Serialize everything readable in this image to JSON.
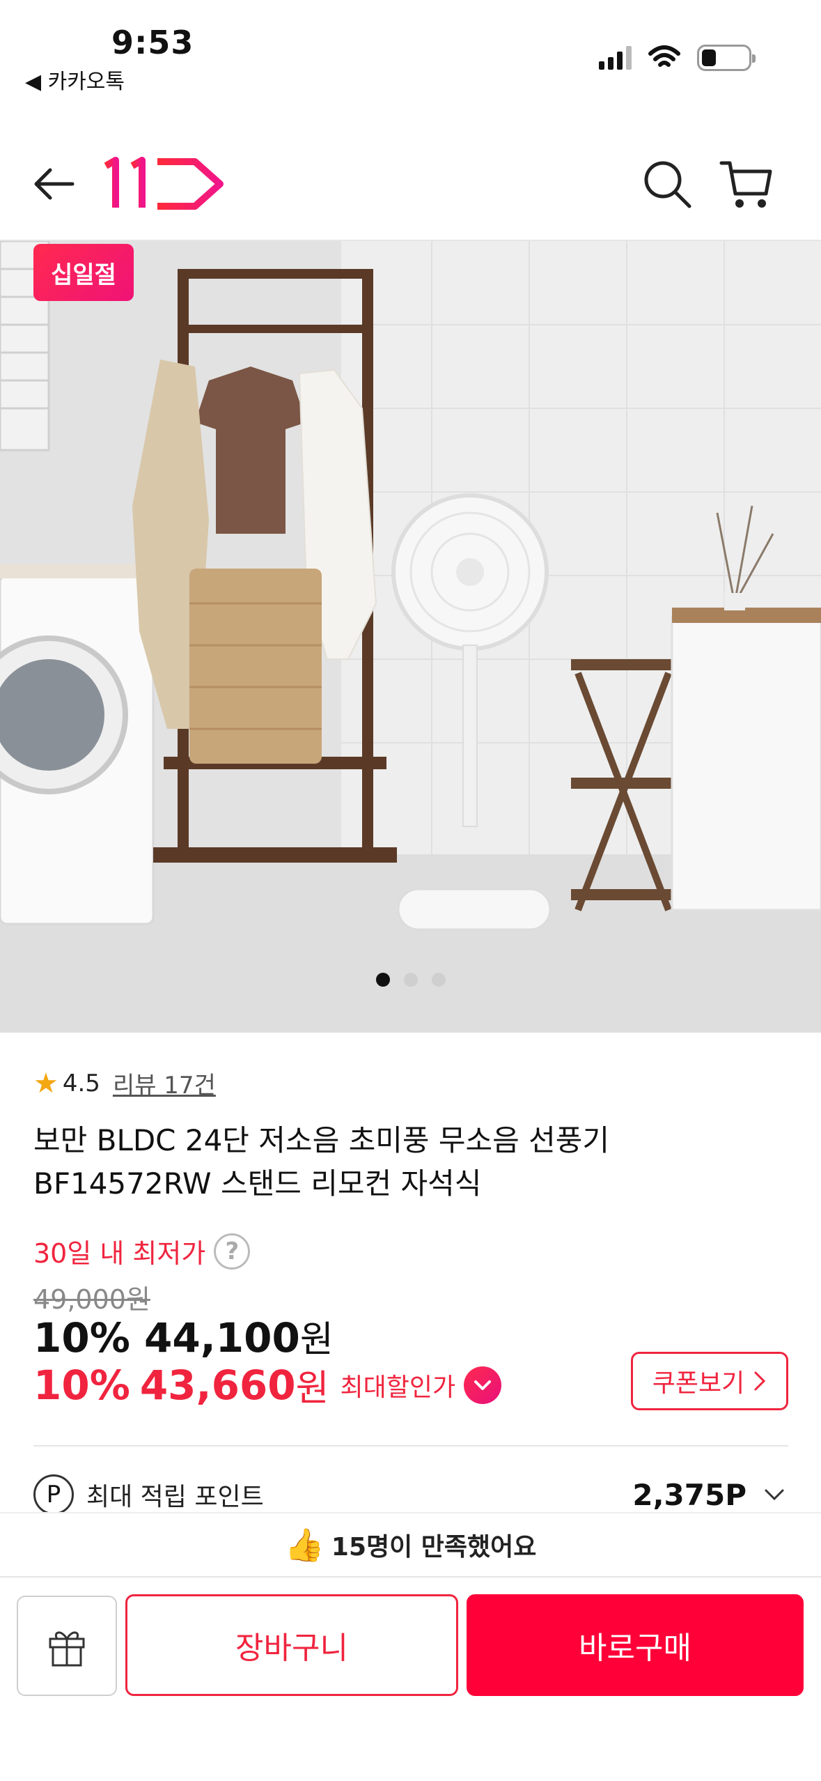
{
  "status_bar": {
    "time": "9:53",
    "back_app": "◀ 카카오톡"
  },
  "header": {
    "logo_text": "11",
    "icons": [
      "back-arrow-icon",
      "logo-icon",
      "search-icon",
      "cart-icon"
    ]
  },
  "hero": {
    "badge": "십일절",
    "dots_count": 3,
    "active_dot": 1
  },
  "product": {
    "rating": "4.5",
    "review_link": "리뷰 17건",
    "title_line1": "보만 BLDC 24단 저소음 초미풍 무소음 선풍기",
    "title_line2": "BF14572RW 스탠드 리모컨 자석식",
    "lowest_label": "30일 내 최저가",
    "original_price": "49,000원",
    "discount_pct": "10%",
    "price": "44,100",
    "price_unit": "원",
    "max_discount_pct": "10%",
    "max_price": "43,660",
    "max_price_unit": "원",
    "max_label": "최대할인가",
    "coupon_button": "쿠폰보기",
    "points_label": "최대 적립 포인트",
    "points_value": "2,375P"
  },
  "satisfaction": {
    "text": "15명이 만족했어요"
  },
  "actions": {
    "cart": "장바구니",
    "buy": "바로구매"
  },
  "colors": {
    "accent": "#f0243e",
    "buy_bg": "#ff0038",
    "star": "#f3a712"
  }
}
